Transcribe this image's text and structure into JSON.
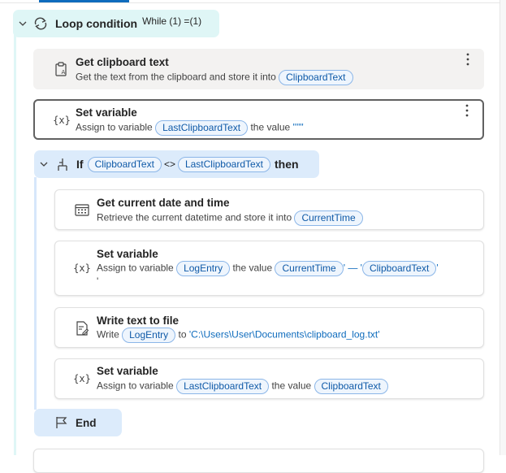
{
  "loop": {
    "title": "Loop condition",
    "condition": "While (1) =(1)"
  },
  "steps": [
    {
      "title": "Get clipboard text",
      "desc_prefix": "Get the text from the clipboard and store it into",
      "var": "ClipboardText",
      "icon": "clipboard-text-icon"
    },
    {
      "title": "Set variable",
      "desc_prefix": "Assign to variable",
      "var": "LastClipboardText",
      "desc_mid": "the value",
      "value": "''\"\"",
      "icon": "variable-icon"
    }
  ],
  "if_block": {
    "keyword": "If",
    "left_var": "ClipboardText",
    "operator": "<>",
    "right_var": "LastClipboardText",
    "then": "then",
    "icon": "if-branch-icon"
  },
  "inner_steps": [
    {
      "title": "Get current date and time",
      "desc_prefix": "Retrieve the current datetime and store it into",
      "var": "CurrentTime",
      "icon": "calendar-icon"
    },
    {
      "title": "Set variable",
      "desc_prefix": "Assign to variable",
      "var": "LogEntry",
      "desc_mid": "the value",
      "var2": "CurrentTime",
      "sep": "' — '",
      "var3": "ClipboardText",
      "tail": "'",
      "icon": "variable-icon"
    },
    {
      "title": "Write text to file",
      "desc_prefix": "Write",
      "var": "LogEntry",
      "desc_mid": "to",
      "path": "'C:\\Users\\User\\Documents\\clipboard_log.txt'",
      "icon": "write-file-icon"
    },
    {
      "title": "Set variable",
      "desc_prefix": "Assign to variable",
      "var": "LastClipboardText",
      "desc_mid": "the value",
      "var2": "ClipboardText",
      "icon": "variable-icon"
    }
  ],
  "end": {
    "label": "End",
    "icon": "end-flag-icon"
  },
  "colors": {
    "loop_bg": "#dff6f6",
    "if_bg": "#dcebfb",
    "pill_border": "#8bb6e8",
    "pill_text": "#0f5aa8",
    "accent": "#0f6cbd"
  }
}
